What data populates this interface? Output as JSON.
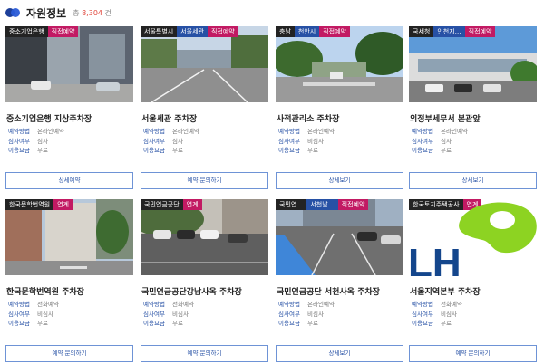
{
  "header": {
    "title": "자원정보",
    "count_prefix": "총",
    "count_value": "8,304",
    "count_suffix": "건"
  },
  "cards": [
    {
      "tags": [
        "중소기업은행",
        "직접예약"
      ],
      "name": "중소기업은행 지상주차장",
      "info": [
        {
          "k": "예약방법",
          "v": "온라인예약"
        },
        {
          "k": "심사여부",
          "v": "심사"
        },
        {
          "k": "이용요금",
          "v": "무료"
        }
      ],
      "button": "상세예약"
    },
    {
      "tags": [
        "서울특별시",
        "서울세관",
        "직접예약"
      ],
      "name": "서울세관 주차장",
      "info": [
        {
          "k": "예약방법",
          "v": "온라인예약"
        },
        {
          "k": "심사여부",
          "v": "심사"
        },
        {
          "k": "이용요금",
          "v": "무료"
        }
      ],
      "button": "예약 문의하기"
    },
    {
      "tags": [
        "충남",
        "천안시",
        "직접예약"
      ],
      "name": "사적관리소 주차장",
      "info": [
        {
          "k": "예약방법",
          "v": "온라인예약"
        },
        {
          "k": "심사여부",
          "v": "비심사"
        },
        {
          "k": "이용요금",
          "v": "무료"
        }
      ],
      "button": "상세보기"
    },
    {
      "tags": [
        "국세청",
        "인천지…",
        "직접예약"
      ],
      "name": "의정부세무서 본관앞",
      "info": [
        {
          "k": "예약방법",
          "v": "온라인예약"
        },
        {
          "k": "심사여부",
          "v": "심사"
        },
        {
          "k": "이용요금",
          "v": "무료"
        }
      ],
      "button": "상세보기"
    },
    {
      "tags": [
        "한국문학번역원",
        "연계"
      ],
      "name": "한국문학번역원 주차장",
      "info": [
        {
          "k": "예약방법",
          "v": "전화예약"
        },
        {
          "k": "심사여부",
          "v": "비심사"
        },
        {
          "k": "이용요금",
          "v": "무료"
        }
      ],
      "button": "예약 문의하기"
    },
    {
      "tags": [
        "국민연금공단",
        "연계"
      ],
      "name": "국민연금공단강남사옥 주차장",
      "info": [
        {
          "k": "예약방법",
          "v": "전화예약"
        },
        {
          "k": "심사여부",
          "v": "비심사"
        },
        {
          "k": "이용요금",
          "v": "무료"
        }
      ],
      "button": "예약 문의하기"
    },
    {
      "tags": [
        "국민연…",
        "서천남…",
        "직접예약"
      ],
      "name": "국민연금공단 서천사옥 주차장",
      "info": [
        {
          "k": "예약방법",
          "v": "온라인예약"
        },
        {
          "k": "심사여부",
          "v": "비심사"
        },
        {
          "k": "이용요금",
          "v": "무료"
        }
      ],
      "button": "상세보기"
    },
    {
      "tags": [
        "한국토지주택공사",
        "연계"
      ],
      "name": "서울지역본부 주차장",
      "info": [
        {
          "k": "예약방법",
          "v": "전화예약"
        },
        {
          "k": "심사여부",
          "v": "비심사"
        },
        {
          "k": "이용요금",
          "v": "무료"
        }
      ],
      "button": "예약 문의하기"
    }
  ],
  "logo_text": "LH",
  "colors": {
    "tag_dark": "#232323",
    "tag_blue": "#2751a5",
    "tag_pink": "#c21a63",
    "count_red": "#e0453a",
    "logo_green": "#8dd322",
    "logo_blue": "#14468c"
  }
}
